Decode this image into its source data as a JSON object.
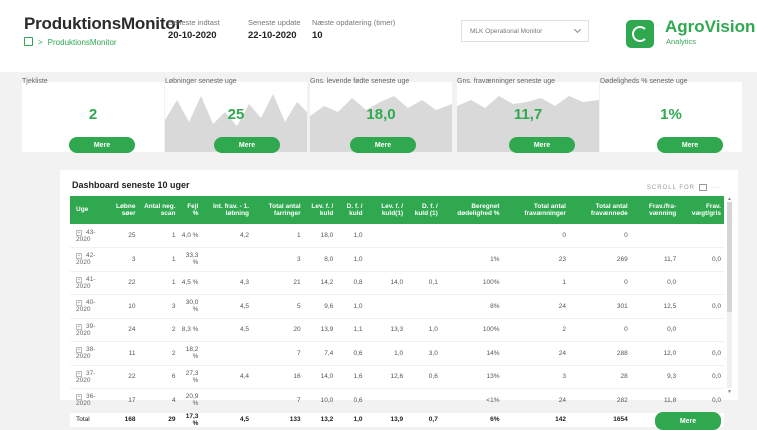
{
  "header": {
    "title": "ProduktionsMonitor",
    "breadcrumb": "ProduktionsMonitor",
    "meta": [
      {
        "label": "Seneste indtast",
        "value": "20-10-2020"
      },
      {
        "label": "Seneste update",
        "value": "22-10-2020"
      },
      {
        "label": "Næste opdatering (timer)",
        "value": "10"
      }
    ],
    "select_value": "MLK Operational Monitor",
    "brand_name": "AgroVision",
    "brand_sub": "Analytics",
    "accent": "#2fa84f"
  },
  "kpis": [
    {
      "label": "Tjekliste",
      "value": "2",
      "button": "Mere"
    },
    {
      "label": "Løbninger seneste uge",
      "value": "25",
      "button": "Mere"
    },
    {
      "label": "Gns. levende fødte seneste uge",
      "value": "18,0",
      "button": "Mere"
    },
    {
      "label": "Gns. fravænninger seneste uge",
      "value": "11,7",
      "button": "Mere"
    },
    {
      "label": "Dødeligheds % seneste uge",
      "value": "1%",
      "button": "Mere"
    }
  ],
  "table": {
    "title": "Dashboard seneste 10 uger",
    "scroll_hint": "SCROLL FOR",
    "columns": [
      "Uge",
      "Løbne søer",
      "Antal neg. scan",
      "Fejl %",
      "Int. frav. - 1. løbning",
      "Total antal farringer",
      "Lev. f. / kuld",
      "D. f. / kuld",
      "Lev. f. / kuld(1)",
      "D. f. / kuld (1)",
      "Beregnet dødelighed %",
      "Total antal fravænninger",
      "Total antal fravænnede",
      "Frav./fra-vænning",
      "Frav. vægt/gris"
    ],
    "rows": [
      [
        "43-2020",
        "25",
        "1",
        "4,0 %",
        "4,2",
        "1",
        "18,0",
        "1,0",
        "",
        "",
        "",
        "0",
        "0",
        "",
        ""
      ],
      [
        "42-2020",
        "3",
        "1",
        "33,3 %",
        "",
        "3",
        "8,0",
        "1,0",
        "",
        "",
        "1%",
        "23",
        "269",
        "11,7",
        "0,0"
      ],
      [
        "41-2020",
        "22",
        "1",
        "4,5 %",
        "4,3",
        "21",
        "14,2",
        "0,8",
        "14,0",
        "0,1",
        "100%",
        "1",
        "0",
        "0,0",
        ""
      ],
      [
        "40-2020",
        "10",
        "3",
        "30,0 %",
        "4,5",
        "5",
        "9,6",
        "1,0",
        "",
        "",
        "8%",
        "24",
        "301",
        "12,5",
        "0,0"
      ],
      [
        "39-2020",
        "24",
        "2",
        "8,3 %",
        "4,5",
        "20",
        "13,9",
        "1,1",
        "13,3",
        "1,0",
        "100%",
        "2",
        "0",
        "0,0",
        ""
      ],
      [
        "38-2020",
        "11",
        "2",
        "18,2 %",
        "",
        "7",
        "7,4",
        "0,6",
        "1,0",
        "3,0",
        "14%",
        "24",
        "288",
        "12,0",
        "0,0"
      ],
      [
        "37-2020",
        "22",
        "6",
        "27,3 %",
        "4,4",
        "16",
        "14,0",
        "1,6",
        "12,6",
        "0,6",
        "13%",
        "3",
        "28",
        "9,3",
        "0,0"
      ],
      [
        "36-2020",
        "17",
        "4",
        "20,9 %",
        "",
        "7",
        "10,0",
        "0,6",
        "",
        "",
        "<1%",
        "24",
        "282",
        "11,8",
        "0,0"
      ]
    ],
    "footer": [
      "Total",
      "168",
      "29",
      "17,3 %",
      "4,5",
      "133",
      "13,2",
      "1,0",
      "13,9",
      "0,7",
      "6%",
      "142",
      "1654",
      "11,6",
      "0,0"
    ],
    "button": "Mere"
  }
}
